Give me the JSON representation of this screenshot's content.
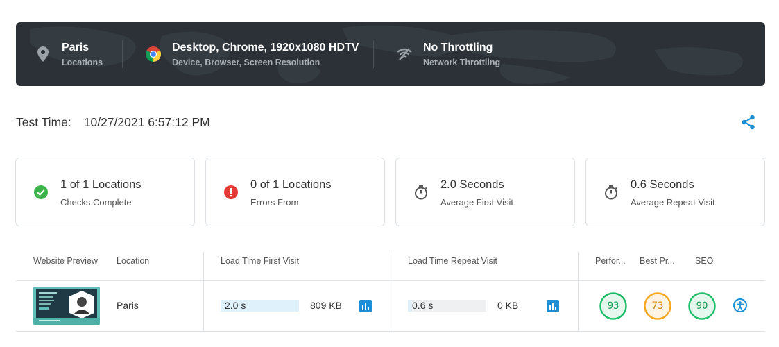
{
  "banner": {
    "location": {
      "title": "Paris",
      "subtitle": "Locations",
      "icon": "location-pin-icon"
    },
    "device": {
      "title": "Desktop, Chrome, 1920x1080 HDTV",
      "subtitle": "Device, Browser, Screen Resolution",
      "icon": "chrome-icon"
    },
    "network": {
      "title": "No Throttling",
      "subtitle": "Network Throttling",
      "icon": "wifi-off-icon"
    }
  },
  "test_time": {
    "label": "Test Time:",
    "value": "10/27/2021 6:57:12 PM",
    "share_icon": "share-icon"
  },
  "cards": [
    {
      "title": "1 of 1 Locations",
      "subtitle": "Checks Complete",
      "icon": "check-circle-icon",
      "color": "#3bb34a"
    },
    {
      "title": "0 of 1 Locations",
      "subtitle": "Errors From",
      "icon": "error-circle-icon",
      "color": "#e53935"
    },
    {
      "title": "2.0 Seconds",
      "subtitle": "Average First Visit",
      "icon": "stopwatch-icon"
    },
    {
      "title": "0.6 Seconds",
      "subtitle": "Average Repeat Visit",
      "icon": "stopwatch-icon"
    }
  ],
  "table": {
    "headers": {
      "preview": "Website Preview",
      "location": "Location",
      "first_visit": "Load Time First Visit",
      "repeat_visit": "Load Time Repeat Visit",
      "performance": "Perfor...",
      "best_practices": "Best Pr...",
      "seo": "SEO"
    },
    "rows": [
      {
        "location": "Paris",
        "first_visit": {
          "time": "2.0 s",
          "size": "809 KB",
          "fill_fraction": 1.0
        },
        "repeat_visit": {
          "time": "0.6 s",
          "size": "0 KB",
          "fill_fraction": 0.05
        },
        "scores": [
          {
            "value": "93",
            "color": "#1fbf6a"
          },
          {
            "value": "73",
            "color": "#f5a623"
          },
          {
            "value": "90",
            "color": "#1fbf6a"
          }
        ]
      }
    ]
  },
  "colors": {
    "accent": "#1d8fd6",
    "banner_bg": "#2b3136"
  }
}
